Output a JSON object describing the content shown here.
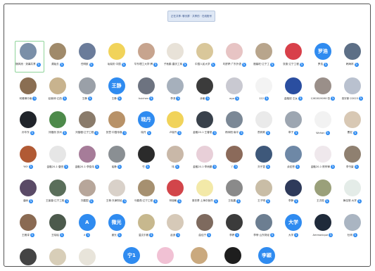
{
  "window": {
    "top_notice": "正在共享: 聊天群 · 共享的 · 在线账号"
  },
  "badge": "S",
  "accent": "#2f8bf0",
  "grid": [
    {
      "name": "随风而 · 荧幕共享",
      "avatar": "",
      "color": "#7a8fa8",
      "selected": true
    },
    {
      "name": "源始去",
      "avatar": "",
      "color": "#a08a6a"
    },
    {
      "name": "任明航",
      "avatar": "",
      "color": "#6b7c9a"
    },
    {
      "name": "灿晓彩·中国",
      "avatar": "",
      "color": "#f1d35a"
    },
    {
      "name": "华东理工大学·牌",
      "avatar": "",
      "color": "#c7a48e"
    },
    {
      "name": "子秋鹤·重庆工商",
      "avatar": "",
      "color": "#e8e2d8"
    },
    {
      "name": "中国人民大学",
      "avatar": "",
      "color": "#d9c79a"
    },
    {
      "name": "刘舒婷·广东外语",
      "avatar": "",
      "color": "#e7c4c4"
    },
    {
      "name": "殷馨旺·辽宁工",
      "avatar": "",
      "color": "#b8a58c"
    },
    {
      "name": "张惠·辽宁工程",
      "avatar": "",
      "color": "#d8404a"
    },
    {
      "name": "罗浩",
      "avatar": "罗浩",
      "color": "#2f8bf0"
    },
    {
      "name": "韩海林",
      "avatar": "",
      "color": "#5d6f86"
    },
    {
      "name": "何雅琳中南",
      "avatar": "",
      "color": "#8a6e52"
    },
    {
      "name": "赵紫琼·辽西",
      "avatar": "",
      "color": "#c8b38e"
    },
    {
      "name": "王静",
      "avatar": "",
      "color": "#9aa0a8"
    },
    {
      "name": "王静",
      "avatar": "王静",
      "color": "#2f8bf0"
    },
    {
      "name": "huichen",
      "avatar": "",
      "color": "#6d7380"
    },
    {
      "name": "李淳",
      "avatar": "",
      "color": "#a6b0bc"
    },
    {
      "name": "余瑜",
      "avatar": "",
      "color": "#3b3b3b"
    },
    {
      "name": "wya",
      "avatar": "",
      "color": "#c9c9d1"
    },
    {
      "name": "122",
      "avatar": "",
      "color": "#f3f3f3"
    },
    {
      "name": "金融班·王女",
      "avatar": "",
      "color": "#2a4ea0"
    },
    {
      "name": "1262819090·张",
      "avatar": "",
      "color": "#9a8f89"
    },
    {
      "name": "钱宇新·22023",
      "avatar": "",
      "color": "#b9c1cf"
    },
    {
      "name": "孙华东",
      "avatar": "",
      "color": "#20242a"
    },
    {
      "name": "刘璐然·苏州",
      "avatar": "",
      "color": "#4d8a4a"
    },
    {
      "name": "刘猫璐·辽宁工程",
      "avatar": "",
      "color": "#8a7b6a"
    },
    {
      "name": "张萱·中国传媒",
      "avatar": "",
      "color": "#b89268"
    },
    {
      "name": "晓丹",
      "avatar": "晓丹",
      "color": "#2f8bf0"
    },
    {
      "name": "卢晓丹",
      "avatar": "",
      "color": "#f1d35a"
    },
    {
      "name": "金融20-1·王春丽",
      "avatar": "",
      "color": "#39414b"
    },
    {
      "name": "杨帅阳·南平",
      "avatar": "",
      "color": "#7b8896"
    },
    {
      "name": "詹莉莉",
      "avatar": "",
      "color": "#eaeaea"
    },
    {
      "name": "章子",
      "avatar": "",
      "color": "#9da6b1"
    },
    {
      "name": "Wchon",
      "avatar": "",
      "color": "#f2f2f2"
    },
    {
      "name": "曹宏",
      "avatar": "",
      "color": "#d8c8b4"
    },
    {
      "name": "YKY",
      "avatar": "",
      "color": "#b15a34"
    },
    {
      "name": "金融20-1·唐悦",
      "avatar": "",
      "color": "#e6e6e6"
    },
    {
      "name": "金融20-1·李俊伟",
      "avatar": "",
      "color": "#a67c99"
    },
    {
      "name": "瑶静",
      "avatar": "",
      "color": "#8a8f93"
    },
    {
      "name": "竹",
      "avatar": "",
      "color": "#2b2b2b"
    },
    {
      "name": "玮",
      "avatar": "",
      "color": "#c9b8a8"
    },
    {
      "name": "金融20-1·李雨鹏",
      "avatar": "",
      "color": "#e8cfd8"
    },
    {
      "name": "丫",
      "avatar": "",
      "color": "#8b6a5a"
    },
    {
      "name": "刘子昱",
      "avatar": "",
      "color": "#3e587a"
    },
    {
      "name": "余宏恩",
      "avatar": "",
      "color": "#6e88a6"
    },
    {
      "name": "金融20-1·陈梓锋",
      "avatar": "",
      "color": "#efe8ec"
    },
    {
      "name": "李书豪",
      "avatar": "",
      "color": "#8f8070"
    },
    {
      "name": "谐树",
      "avatar": "",
      "color": "#5a4a66"
    },
    {
      "name": "王宸普·辽宁工程",
      "avatar": "",
      "color": "#5a6e5a"
    },
    {
      "name": "刘建国",
      "avatar": "",
      "color": "#b7a69a"
    },
    {
      "name": "王杨·天津财经",
      "avatar": "",
      "color": "#d9d1c9"
    },
    {
      "name": "马春燕·辽宁工程",
      "avatar": "",
      "color": "#a69070"
    },
    {
      "name": "林晓敏",
      "avatar": "",
      "color": "#d2454a"
    },
    {
      "name": "薰衣草·上海中医药",
      "avatar": "",
      "color": "#f3e9a8"
    },
    {
      "name": "王晓晨",
      "avatar": "",
      "color": "#8a8a8a"
    },
    {
      "name": "王子明",
      "avatar": "",
      "color": "#c9bda6"
    },
    {
      "name": "李静",
      "avatar": "",
      "color": "#2e3a5a"
    },
    {
      "name": "王洪茹",
      "avatar": "",
      "color": "#9aa07a"
    },
    {
      "name": "黄佳慧·大学",
      "avatar": "",
      "color": "#e4ece8"
    },
    {
      "name": "王雅淳",
      "avatar": "",
      "color": "#8a6a52"
    },
    {
      "name": "王晓瑶",
      "avatar": "",
      "color": "#4c5a4c"
    },
    {
      "name": "A",
      "avatar": "A",
      "color": "#2f8bf0"
    },
    {
      "name": "微光",
      "avatar": "微光",
      "color": "#2f8bf0"
    },
    {
      "name": "温文尔雅",
      "avatar": "",
      "color": "#c7b88e"
    },
    {
      "name": "赵彦",
      "avatar": "",
      "color": "#d6c9b8"
    },
    {
      "name": "曲佳宁",
      "avatar": "",
      "color": "#7e6a5e"
    },
    {
      "name": "李婷",
      "avatar": "",
      "color": "#3b3b3b"
    },
    {
      "name": "李菲·山东财经",
      "avatar": "",
      "color": "#6c7e91"
    },
    {
      "name": "大学",
      "avatar": "大学",
      "color": "#2f8bf0"
    },
    {
      "name": "Ammonique",
      "avatar": "",
      "color": "#1f2a3a"
    },
    {
      "name": "杜明",
      "avatar": "",
      "color": "#aab5c2"
    },
    {
      "name": "金融20-1·赵诗涵",
      "avatar": "",
      "color": "#444"
    },
    {
      "name": "wm",
      "avatar": "",
      "color": "#d8ceb8"
    },
    {
      "name": "121",
      "avatar": "",
      "color": "#e8e4da"
    }
  ],
  "bottom": [
    {
      "name": "金融20-1·宁",
      "avatar": "宁1",
      "color": "#2f8bf0"
    },
    {
      "name": "张悦",
      "avatar": "",
      "color": "#f1c1d4"
    },
    {
      "name": "刘明",
      "avatar": "",
      "color": "#caa97e"
    },
    {
      "name": "梅玲",
      "avatar": "",
      "color": "#1e1e1e"
    },
    {
      "name": "李颖",
      "avatar": "李颖",
      "color": "#2f8bf0"
    }
  ]
}
